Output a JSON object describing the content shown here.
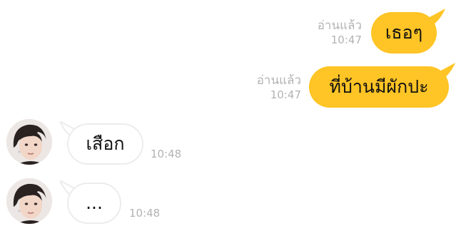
{
  "colors": {
    "outgoing_bubble": "#ffc425",
    "incoming_bubble": "#ffffff",
    "incoming_border": "#ececec",
    "meta_text": "#b3b3b3"
  },
  "messages": [
    {
      "direction": "outgoing",
      "text": "เธอๆ",
      "read_status": "อ่านแล้ว",
      "time": "10:47"
    },
    {
      "direction": "outgoing",
      "text": "ที่บ้านมีผักปะ",
      "read_status": "อ่านแล้ว",
      "time": "10:47"
    },
    {
      "direction": "incoming",
      "text": "เสือก",
      "time": "10:48",
      "avatar_icon": "user-avatar-icon"
    },
    {
      "direction": "incoming",
      "text": "...",
      "time": "10:48",
      "avatar_icon": "user-avatar-icon"
    }
  ]
}
